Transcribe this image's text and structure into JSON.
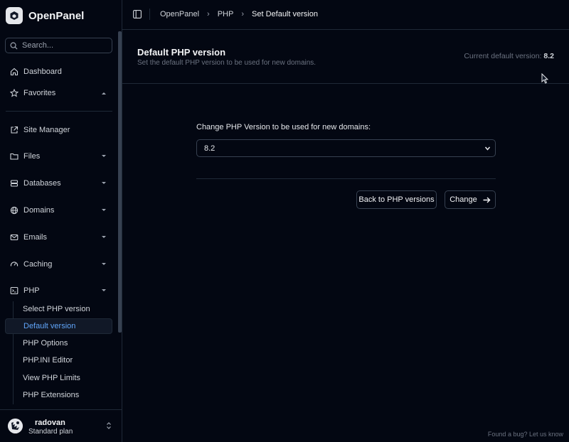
{
  "brand": {
    "name": "OpenPanel",
    "icon": "openpanel-logo-icon"
  },
  "search": {
    "placeholder": "Search..."
  },
  "sidebar": {
    "items": [
      {
        "label": "Dashboard",
        "icon": "home-icon"
      },
      {
        "label": "Favorites",
        "icon": "star-icon",
        "expanded": true
      },
      {
        "label": "Site Manager",
        "icon": "external-link-icon"
      },
      {
        "label": "Files",
        "icon": "folder-icon"
      },
      {
        "label": "Databases",
        "icon": "database-icon"
      },
      {
        "label": "Domains",
        "icon": "globe-icon"
      },
      {
        "label": "Emails",
        "icon": "mail-icon"
      },
      {
        "label": "Caching",
        "icon": "gauge-icon"
      },
      {
        "label": "PHP",
        "icon": "terminal-icon",
        "expanded": true
      }
    ],
    "php_subitems": [
      {
        "label": "Select PHP version"
      },
      {
        "label": "Default version",
        "active": true
      },
      {
        "label": "PHP Options"
      },
      {
        "label": "PHP.INI Editor"
      },
      {
        "label": "View PHP Limits"
      },
      {
        "label": "PHP Extensions"
      }
    ]
  },
  "user": {
    "name": "radovan",
    "plan": "Standard plan"
  },
  "breadcrumb": [
    "OpenPanel",
    "PHP",
    "Set Default version"
  ],
  "header": {
    "title": "Default PHP version",
    "subtitle": "Set the default PHP version to be used for new domains.",
    "current_label": "Current default version:",
    "current_value": "8.2"
  },
  "form": {
    "label": "Change PHP Version to be used for new domains:",
    "selected": "8.2"
  },
  "buttons": {
    "back": "Back to PHP versions",
    "change": "Change"
  },
  "footer": {
    "bug_link": "Found a bug? Let us know"
  },
  "colors": {
    "background": "#030712",
    "accent": "#60a5fa",
    "border": "#1f2937"
  }
}
